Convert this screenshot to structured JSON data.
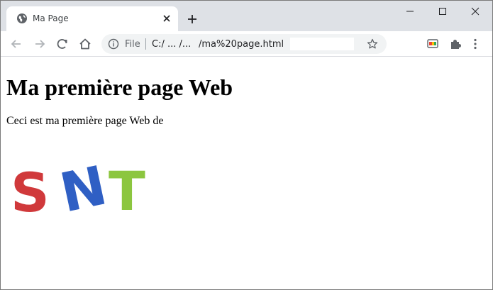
{
  "tab": {
    "title": "Ma Page"
  },
  "omnibox": {
    "scheme_label": "File",
    "url_part1": "C:/ ... /...",
    "url_part2": "/ma%20page.html"
  },
  "page": {
    "heading": "Ma première page Web",
    "paragraph": "Ceci est ma première page Web de",
    "logo_text": "SNT",
    "logo_colors": {
      "S": "#d0393b",
      "N": "#2f5fc4",
      "T": "#8cc63f"
    }
  },
  "icons": [
    "globe-icon",
    "close-icon",
    "plus-icon",
    "minimize-icon",
    "maximize-icon",
    "window-close-icon",
    "back-arrow-icon",
    "forward-arrow-icon",
    "reload-icon",
    "home-icon",
    "info-icon",
    "star-icon",
    "cast-icon",
    "puzzle-icon",
    "more-vert-icon"
  ]
}
